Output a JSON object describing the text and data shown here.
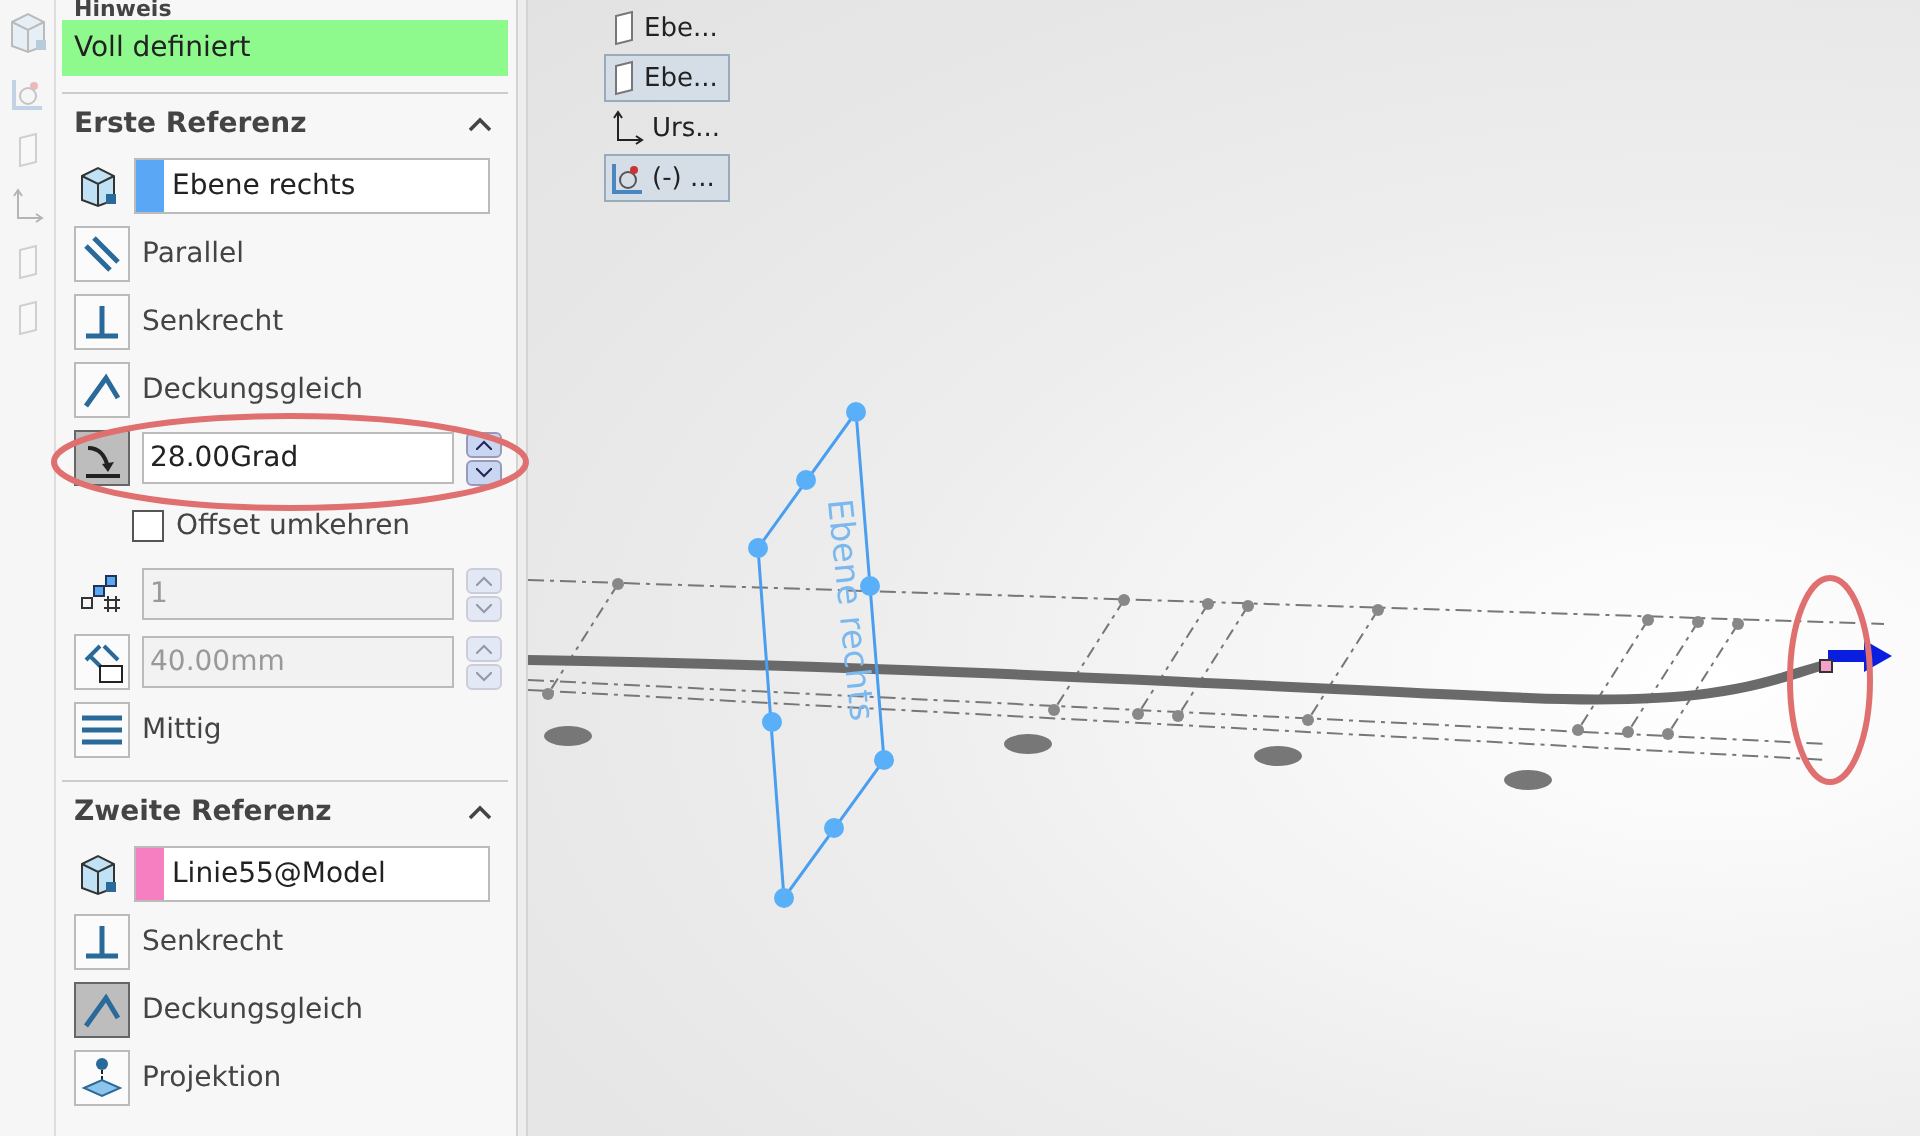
{
  "hint": {
    "title": "Hinweis",
    "status": "Voll definiert"
  },
  "sections": [
    {
      "title": "Erste Referenz",
      "expanded": true,
      "rows": [
        {
          "kind": "reference",
          "value": "Ebene rechts",
          "color": "#5aa8f5"
        },
        {
          "kind": "toggle",
          "label": "Parallel",
          "selected": false
        },
        {
          "kind": "toggle",
          "label": "Senkrecht",
          "selected": false
        },
        {
          "kind": "toggle",
          "label": "Deckungsgleich",
          "selected": false
        },
        {
          "kind": "spin",
          "value": "28.00Grad",
          "selected": true,
          "disabled": false
        },
        {
          "kind": "checkbox",
          "label": "Offset umkehren",
          "checked": false
        },
        {
          "kind": "spin",
          "value": "1",
          "selected": false,
          "disabled": true
        },
        {
          "kind": "spin",
          "value": "40.00mm",
          "selected": false,
          "disabled": true
        },
        {
          "kind": "toggle",
          "label": "Mittig",
          "selected": false
        }
      ]
    },
    {
      "title": "Zweite Referenz",
      "expanded": true,
      "rows": [
        {
          "kind": "reference",
          "value": "Linie55@Model",
          "color": "#f57fc0"
        },
        {
          "kind": "toggle",
          "label": "Senkrecht",
          "selected": false
        },
        {
          "kind": "toggle",
          "label": "Deckungsgleich",
          "selected": true
        },
        {
          "kind": "toggle",
          "label": "Projektion",
          "selected": false
        }
      ]
    }
  ],
  "tree": [
    {
      "label": "Ebe...",
      "selected": false
    },
    {
      "label": "Ebe...",
      "selected": true
    },
    {
      "label": "Urs...",
      "selected": false
    },
    {
      "label": "(-) ...",
      "selected": true
    }
  ],
  "plane_label": "Ebene rechts"
}
